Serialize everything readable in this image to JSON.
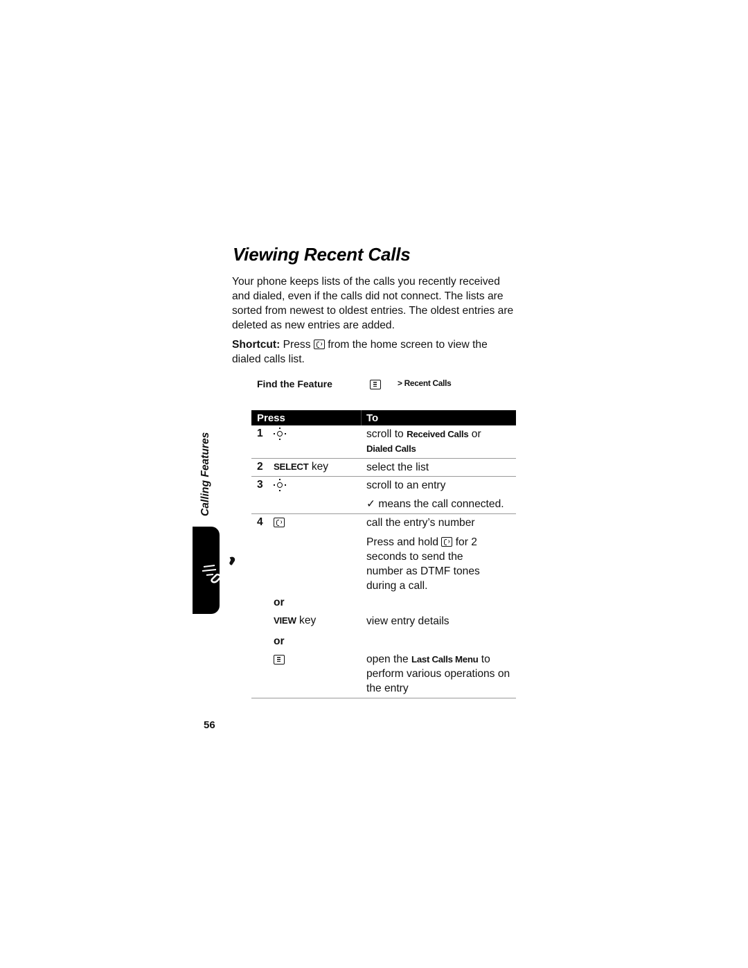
{
  "page": {
    "title": "Viewing Recent Calls",
    "intro": "Your phone keeps lists of the calls you recently received and dialed, even if the calls did not connect. The lists are sorted from newest to oldest entries. The oldest entries are deleted as new entries are added.",
    "shortcut": {
      "label": "Shortcut:",
      "before_icon": "Press",
      "icon": "send-key-icon",
      "after_icon": "from the home screen to view the dialed calls list."
    },
    "find_feature": {
      "label": "Find the Feature",
      "icon": "menu-key-icon",
      "path": "> Recent Calls"
    },
    "table": {
      "headers": {
        "press": "Press",
        "to": "To"
      },
      "rows": [
        {
          "num": "1",
          "press_icon": "nav-scroll-icon",
          "to_prefix": "scroll to",
          "to_bold1": "Received Calls",
          "to_mid": "or",
          "to_bold2": "Dialed Calls"
        },
        {
          "num": "2",
          "press_bold": "SELECT",
          "press_text": "key",
          "to": "select the list"
        },
        {
          "num": "3",
          "press_icon": "nav-scroll-icon",
          "to": "scroll to an entry",
          "note": "✓ means the call connected."
        },
        {
          "num": "4",
          "press_icon": "send-key-icon",
          "to": "call the entry’s number",
          "note_before": "Press and hold",
          "note_after": "for 2 seconds to send the number as DTMF tones during a call."
        }
      ],
      "alternatives": [
        {
          "or": "or",
          "press_bold": "VIEW",
          "press_text": "key",
          "to": "view entry details"
        },
        {
          "or": "or",
          "press_icon": "menu-key-icon",
          "to_prefix": "open the",
          "to_bold": "Last Calls Menu",
          "to_suffix": "to perform various operations on the entry"
        }
      ]
    },
    "side_label": "Calling Features",
    "section_icon": "phone-calling-icon",
    "page_number": "56"
  }
}
